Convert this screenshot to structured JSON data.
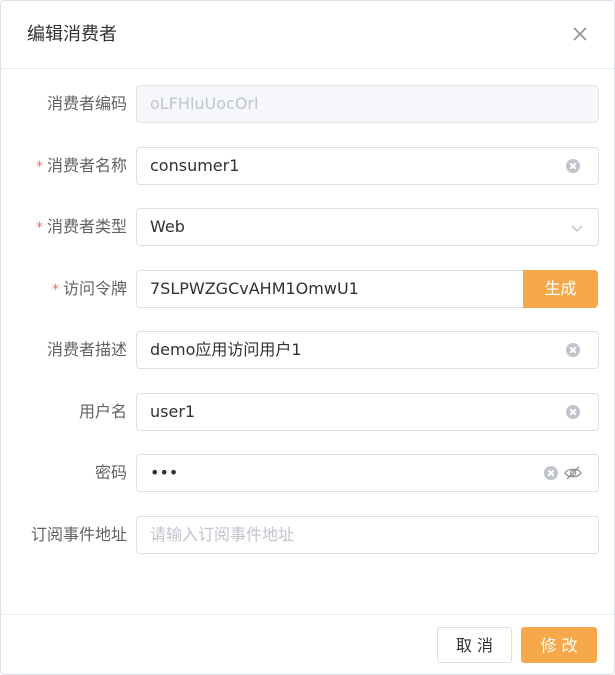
{
  "dialog": {
    "title": "编辑消费者"
  },
  "form": {
    "consumer_code": {
      "label": "消费者编码",
      "value": "oLFHluUocOrl"
    },
    "consumer_name": {
      "label": "消费者名称",
      "value": "consumer1"
    },
    "consumer_type": {
      "label": "消费者类型",
      "value": "Web"
    },
    "access_token": {
      "label": "访问令牌",
      "value": "7SLPWZGCvAHM1OmwU1",
      "generate_label": "生成"
    },
    "description": {
      "label": "消费者描述",
      "value": "demo应用访问用户1"
    },
    "username": {
      "label": "用户名",
      "value": "user1"
    },
    "password": {
      "label": "密码",
      "value": "•••"
    },
    "subscribe_url": {
      "label": "订阅事件地址",
      "placeholder": "请输入订阅事件地址"
    },
    "required_mark": "*"
  },
  "footer": {
    "cancel_label": "取 消",
    "submit_label": "修 改"
  },
  "colors": {
    "accent": "#f5a94a",
    "required": "#f56c6c"
  }
}
